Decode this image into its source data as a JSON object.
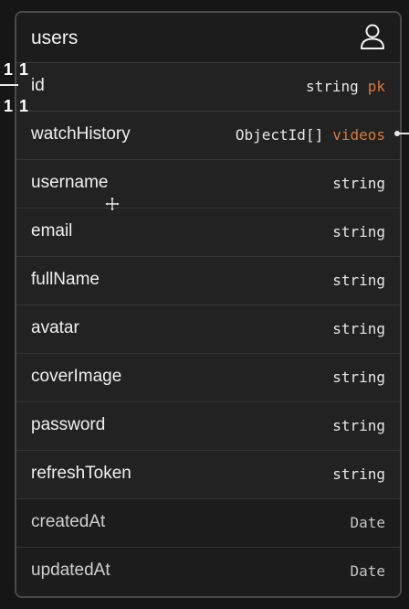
{
  "table": {
    "title": "users",
    "icon": "user-icon",
    "fields": [
      {
        "name": "id",
        "type": "string",
        "key": "pk"
      },
      {
        "name": "watchHistory",
        "type": "ObjectId[]",
        "key": "videos"
      },
      {
        "name": "username",
        "type": "string"
      },
      {
        "name": "email",
        "type": "string"
      },
      {
        "name": "fullName",
        "type": "string"
      },
      {
        "name": "avatar",
        "type": "string"
      },
      {
        "name": "coverImage",
        "type": "string"
      },
      {
        "name": "password",
        "type": "string"
      },
      {
        "name": "refreshToken",
        "type": "string"
      },
      {
        "name": "createdAt",
        "type": "Date"
      },
      {
        "name": "updatedAt",
        "type": "Date"
      }
    ]
  },
  "relations": {
    "id_cardinality_top": "1 1",
    "id_cardinality_bottom": "1 1"
  },
  "colors": {
    "background": "#161616",
    "card": "#1f1f1f",
    "border": "#4a4a4a",
    "text": "#f0f0f0",
    "key_accent": "#d9793a"
  }
}
